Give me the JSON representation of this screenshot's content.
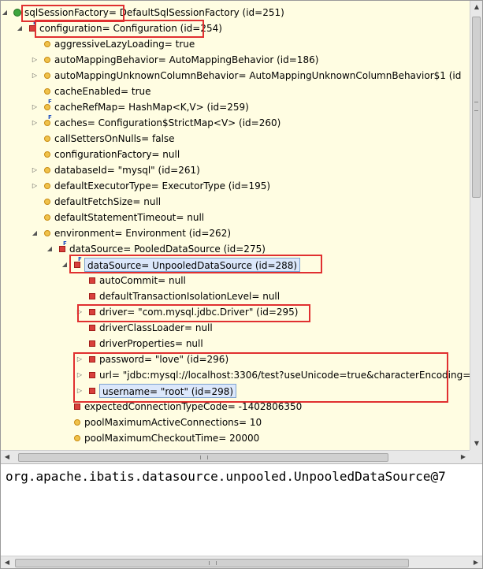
{
  "tree": {
    "rows": [
      {
        "depth": 0,
        "twisty": "expanded",
        "icon": "green-circle",
        "final": false,
        "label": "sqlSessionFactory= DefaultSqlSessionFactory  (id=251)"
      },
      {
        "depth": 1,
        "twisty": "expanded",
        "icon": "red-square",
        "final": true,
        "label": "configuration= Configuration  (id=254)"
      },
      {
        "depth": 2,
        "twisty": "none",
        "icon": "yellow-circle",
        "final": false,
        "label": "aggressiveLazyLoading= true"
      },
      {
        "depth": 2,
        "twisty": "collapsed",
        "icon": "yellow-circle",
        "final": false,
        "label": "autoMappingBehavior= AutoMappingBehavior  (id=186)"
      },
      {
        "depth": 2,
        "twisty": "collapsed",
        "icon": "yellow-circle",
        "final": false,
        "label": "autoMappingUnknownColumnBehavior= AutoMappingUnknownColumnBehavior$1  (id"
      },
      {
        "depth": 2,
        "twisty": "none",
        "icon": "yellow-circle",
        "final": false,
        "label": "cacheEnabled= true"
      },
      {
        "depth": 2,
        "twisty": "collapsed",
        "icon": "yellow-circle",
        "final": true,
        "label": "cacheRefMap= HashMap<K,V>  (id=259)"
      },
      {
        "depth": 2,
        "twisty": "collapsed",
        "icon": "yellow-circle",
        "final": true,
        "label": "caches= Configuration$StrictMap<V>  (id=260)"
      },
      {
        "depth": 2,
        "twisty": "none",
        "icon": "yellow-circle",
        "final": false,
        "label": "callSettersOnNulls= false"
      },
      {
        "depth": 2,
        "twisty": "none",
        "icon": "yellow-circle",
        "final": false,
        "label": "configurationFactory= null"
      },
      {
        "depth": 2,
        "twisty": "collapsed",
        "icon": "yellow-circle",
        "final": false,
        "label": "databaseId= \"mysql\" (id=261)"
      },
      {
        "depth": 2,
        "twisty": "collapsed",
        "icon": "yellow-circle",
        "final": false,
        "label": "defaultExecutorType= ExecutorType  (id=195)"
      },
      {
        "depth": 2,
        "twisty": "none",
        "icon": "yellow-circle",
        "final": false,
        "label": "defaultFetchSize= null"
      },
      {
        "depth": 2,
        "twisty": "none",
        "icon": "yellow-circle",
        "final": false,
        "label": "defaultStatementTimeout= null"
      },
      {
        "depth": 2,
        "twisty": "expanded",
        "icon": "yellow-circle",
        "final": false,
        "label": "environment= Environment  (id=262)"
      },
      {
        "depth": 3,
        "twisty": "expanded",
        "icon": "red-square",
        "final": true,
        "label": "dataSource= PooledDataSource  (id=275)"
      },
      {
        "depth": 4,
        "twisty": "expanded",
        "icon": "red-square",
        "final": true,
        "label": "dataSource= UnpooledDataSource  (id=288)",
        "selected": true
      },
      {
        "depth": 5,
        "twisty": "none",
        "icon": "red-square",
        "final": false,
        "label": "autoCommit= null"
      },
      {
        "depth": 5,
        "twisty": "none",
        "icon": "red-square",
        "final": false,
        "label": "defaultTransactionIsolationLevel= null"
      },
      {
        "depth": 5,
        "twisty": "collapsed",
        "icon": "red-square",
        "final": false,
        "label": "driver= \"com.mysql.jdbc.Driver\" (id=295)"
      },
      {
        "depth": 5,
        "twisty": "none",
        "icon": "red-square",
        "final": false,
        "label": "driverClassLoader= null"
      },
      {
        "depth": 5,
        "twisty": "none",
        "icon": "red-square",
        "final": false,
        "label": "driverProperties= null"
      },
      {
        "depth": 5,
        "twisty": "collapsed",
        "icon": "red-square",
        "final": false,
        "label": "password= \"love\" (id=296)"
      },
      {
        "depth": 5,
        "twisty": "collapsed",
        "icon": "red-square",
        "final": false,
        "label": "url= \"jdbc:mysql://localhost:3306/test?useUnicode=true&characterEncoding="
      },
      {
        "depth": 5,
        "twisty": "collapsed",
        "icon": "red-square",
        "final": false,
        "label": "username= \"root\" (id=298)",
        "selected": true
      },
      {
        "depth": 4,
        "twisty": "none",
        "icon": "red-square",
        "final": false,
        "label": "expectedConnectionTypeCode= -1402806350"
      },
      {
        "depth": 4,
        "twisty": "none",
        "icon": "yellow-circle",
        "final": false,
        "label": "poolMaximumActiveConnections= 10"
      },
      {
        "depth": 4,
        "twisty": "none",
        "icon": "yellow-circle",
        "final": false,
        "label": "poolMaximumCheckoutTime= 20000"
      }
    ]
  },
  "detail": {
    "text": "org.apache.ibatis.datasource.unpooled.UnpooledDataSource@7"
  },
  "colors": {
    "tree_background": "#fffde2",
    "highlight_border": "#e03030",
    "selection_background": "#dbe7fb"
  }
}
